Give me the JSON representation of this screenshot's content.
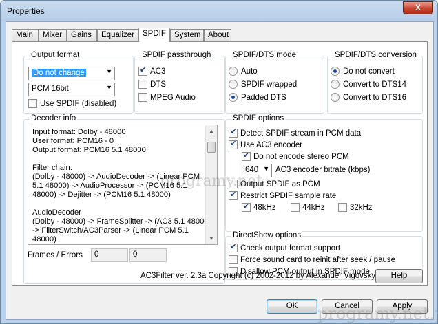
{
  "window": {
    "title": "Properties",
    "close_glyph": "X"
  },
  "tabs": [
    {
      "label": "Main"
    },
    {
      "label": "Mixer"
    },
    {
      "label": "Gains"
    },
    {
      "label": "Equalizer"
    },
    {
      "label": "SPDIF"
    },
    {
      "label": "System"
    },
    {
      "label": "About"
    }
  ],
  "active_tab": "SPDIF",
  "output_format": {
    "title": "Output format",
    "combo1": "Do not change",
    "combo2": "PCM 16bit",
    "use_spdif": {
      "label": "Use SPDIF (disabled)",
      "checked": false
    }
  },
  "passthrough": {
    "title": "SPDIF passthrough",
    "items": [
      {
        "label": "AC3",
        "checked": true
      },
      {
        "label": "DTS",
        "checked": false
      },
      {
        "label": "MPEG Audio",
        "checked": false
      }
    ]
  },
  "dts_mode": {
    "title": "SPDIF/DTS mode",
    "options": [
      {
        "label": "Auto",
        "selected": false
      },
      {
        "label": "SPDIF wrapped",
        "selected": false
      },
      {
        "label": "Padded DTS",
        "selected": true
      }
    ]
  },
  "dts_conversion": {
    "title": "SPDIF/DTS conversion",
    "options": [
      {
        "label": "Do not convert",
        "selected": true
      },
      {
        "label": "Convert to DTS14",
        "selected": false
      },
      {
        "label": "Convert to DTS16",
        "selected": false
      }
    ]
  },
  "decoder_info": {
    "title": "Decoder info",
    "text": "Input format: Dolby - 48000\nUser format: PCM16 - 0\nOutput format: PCM16 5.1 48000\n\nFilter chain:\n(Dolby - 48000) -> AudioDecoder -> (Linear PCM\n5.1 48000) -> AudioProcessor -> (PCM16 5.1\n48000) -> Dejitter -> (PCM16 5.1 48000)\n\nAudioDecoder\n(Dolby - 48000) -> FrameSplitter -> (AC3 5.1 48000)\n-> FilterSwitch/AC3Parser -> (Linear PCM 5.1\n48000)",
    "frames_label": "Frames / Errors",
    "frames": "0",
    "errors": "0"
  },
  "spdif_options": {
    "title": "SPDIF options",
    "detect": {
      "label": "Detect SPDIF stream in PCM data",
      "checked": true
    },
    "use_ac3": {
      "label": "Use AC3 encoder",
      "checked": true
    },
    "no_stereo": {
      "label": "Do not encode stereo PCM",
      "checked": true
    },
    "bitrate_value": "640",
    "bitrate_label": "AC3 encoder bitrate (kbps)",
    "output_pcm": {
      "label": "Output SPDIF as PCM",
      "checked": false
    },
    "restrict": {
      "label": "Restrict SPDIF sample rate",
      "checked": true
    },
    "rates": [
      {
        "label": "48kHz",
        "checked": true
      },
      {
        "label": "44kHz",
        "checked": false
      },
      {
        "label": "32kHz",
        "checked": false
      }
    ]
  },
  "directshow": {
    "title": "DirectShow options",
    "items": [
      {
        "label": "Check output format support",
        "checked": true
      },
      {
        "label": "Force sound card to reinit after seek / pause",
        "checked": false
      },
      {
        "label": "Disallow PCM output in SPDIF mode",
        "checked": false
      }
    ]
  },
  "copyright": "AC3Filter ver. 2.3a Copyright (c) 2002-2012 by Alexander Vigovsky",
  "buttons": {
    "help": "Help",
    "ok": "OK",
    "cancel": "Cancel",
    "apply": "Apply"
  },
  "watermarks": {
    "center": "programy.net",
    "corner": "programy.net.pl"
  }
}
